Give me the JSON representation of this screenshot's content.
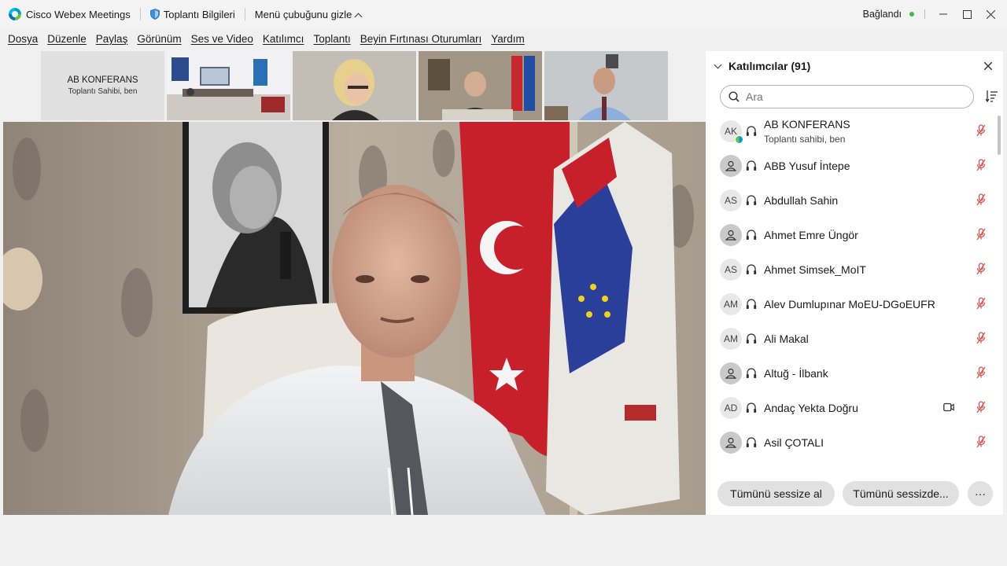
{
  "titlebar": {
    "app_title": "Cisco Webex Meetings",
    "meeting_info": "Toplantı Bilgileri",
    "hide_menu": "Menü çubuğunu gizle",
    "status": "Bağlandı",
    "status_color": "#3fb950"
  },
  "menu": [
    "Dosya",
    "Düzenle",
    "Paylaş",
    "Görünüm",
    "Ses ve Video",
    "Katılımcı",
    "Toplantı",
    "Beyin Fırtınası Oturumları",
    "Yardım"
  ],
  "thumbnails": {
    "host_name": "AB KONFERANS",
    "host_role": "Toplantı Sahibi, ben"
  },
  "panel": {
    "title": "Katılımcılar (91)",
    "search_placeholder": "Ara",
    "participants": [
      {
        "initials": "AK",
        "name": "AB KONFERANS",
        "role": "Toplantı sahibi, ben",
        "avatar": "initials",
        "video": false
      },
      {
        "initials": "",
        "name": "ABB Yusuf İntepe",
        "role": "",
        "avatar": "generic",
        "video": false
      },
      {
        "initials": "AS",
        "name": "Abdullah Sahin",
        "role": "",
        "avatar": "initials",
        "video": false
      },
      {
        "initials": "",
        "name": "Ahmet Emre Üngör",
        "role": "",
        "avatar": "generic",
        "video": false
      },
      {
        "initials": "AS",
        "name": "Ahmet Simsek_MoIT",
        "role": "",
        "avatar": "initials",
        "video": false
      },
      {
        "initials": "AM",
        "name": "Alev Dumlupınar MoEU-DGoEUFR",
        "role": "",
        "avatar": "initials",
        "video": false
      },
      {
        "initials": "AM",
        "name": "Ali Makal",
        "role": "",
        "avatar": "initials",
        "video": false
      },
      {
        "initials": "",
        "name": "Altuğ - İlbank",
        "role": "",
        "avatar": "generic",
        "video": false
      },
      {
        "initials": "AD",
        "name": "Andaç Yekta Doğru",
        "role": "",
        "avatar": "initials",
        "video": true
      },
      {
        "initials": "",
        "name": "Asil ÇOTALI",
        "role": "",
        "avatar": "generic",
        "video": false
      }
    ],
    "mute_all": "Tümünü sessize al",
    "unmute_all": "Tümünü sessizde...",
    "more": "···",
    "mute_color": "#d9534f"
  }
}
